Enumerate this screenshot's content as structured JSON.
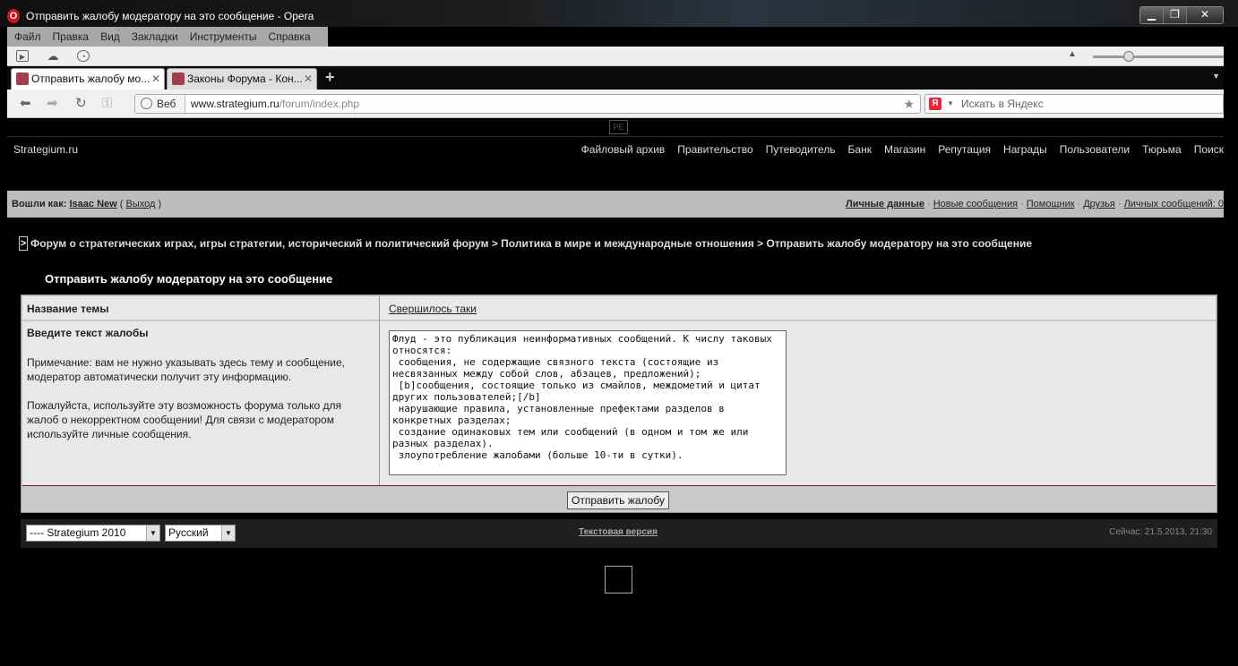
{
  "window": {
    "title": "Отправить жалобу модератору на это сообщение - Opera",
    "logo_letter": "O",
    "minimize": "▁",
    "maximize": "❐",
    "close": "✕"
  },
  "menu": [
    "Файл",
    "Правка",
    "Вид",
    "Закладки",
    "Инструменты",
    "Справка"
  ],
  "tabs": [
    {
      "label": "Отправить жалобу мо...",
      "active": true
    },
    {
      "label": "Законы Форума - Кон...",
      "active": false
    }
  ],
  "address_bar": {
    "web_label": "Веб",
    "url_host": "www.strategium.ru",
    "url_path": "/forum/index.php",
    "search_engine_letter": "Я",
    "search_placeholder": "Искать в Яндекс"
  },
  "page_badge": "PE",
  "site": {
    "brand": "Strategium.ru",
    "nav": [
      "Файловый архив",
      "Правительство",
      "Путеводитель",
      "Банк",
      "Магазин",
      "Репутация",
      "Награды",
      "Пользователи",
      "Тюрьма",
      "Поиск"
    ]
  },
  "userbar": {
    "logged_in_as": "Вошли как:",
    "username": "Isaac New",
    "logout": "Выход",
    "links": [
      "Личные данные",
      "Новые сообщения",
      "Помощник",
      "Друзья",
      "Личных сообщений: 0"
    ]
  },
  "breadcrumb": {
    "arrow": ">",
    "text": "Форум о стратегических играх, игры стратегии, исторический и политический форум > Политика в мире и международные отношения > Отправить жалобу модератору на это сообщение"
  },
  "form": {
    "title": "Отправить жалобу модератору на это сообщение",
    "topic_label": "Название темы",
    "topic_value": "Свершилось таки",
    "complaint_label": "Введите текст жалобы",
    "note1": "Примечание: вам не нужно указывать здесь тему и сообщение, модератор автоматически получит эту информацию.",
    "note2": "Пожалуйста, используйте эту возможность форума только для жалоб о некорректном сообщении! Для связи с модератором используйте личные сообщения.",
    "complaint_text": "Флуд - это публикация неинформативных сообщений. К числу таковых относятся:\n сообщения, не содержащие связного текста (состоящие из несвязанных между собой слов, абзацев, предложений);\n [b]сообщения, состоящие только из смайлов, междометий и цитат других пользователей;[/b]\n нарушающие правила, установленные префектами разделов в конкретных разделах;\n создание одинаковых тем или сообщений (в одном и том же или разных разделах).\n злоупотребление жалобами (больше 10-ти в сутки).",
    "submit": "Отправить жалобу"
  },
  "footer": {
    "skin_select": "---- Strategium 2010",
    "lang_select": "Русский",
    "text_version": "Текстовая версия",
    "now": "Сейчас: 21.5.2013, 21:30"
  },
  "colors": {
    "page_bg": "#000000",
    "userbar_bg": "#bdbdbd",
    "panel_bg": "#e8e8e8",
    "divider_red": "#7a1c1c"
  }
}
